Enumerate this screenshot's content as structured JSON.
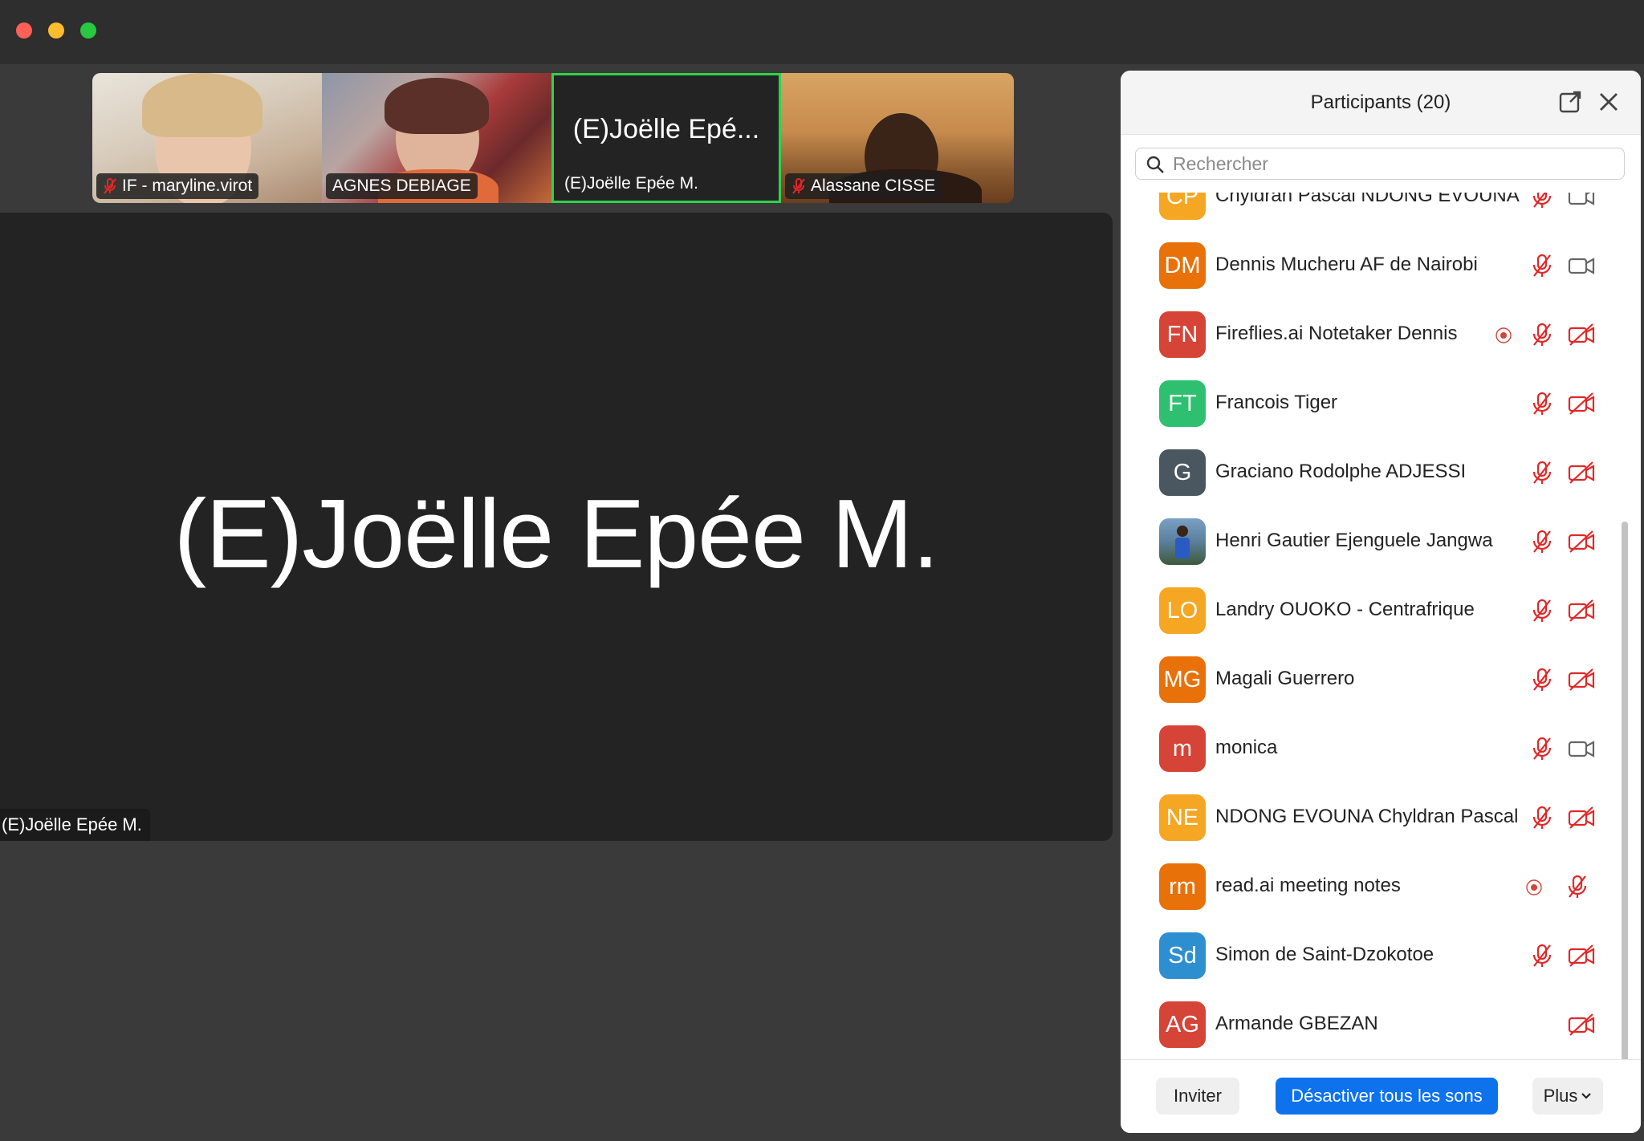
{
  "window": {
    "controls": [
      "close",
      "minimize",
      "zoom"
    ]
  },
  "thumbnails": [
    {
      "name": "IF - maryline.virot",
      "muted": true
    },
    {
      "name": "AGNES DEBIAGE",
      "muted": false
    },
    {
      "name": "(E)Joëlle Epée M.",
      "center_label": "(E)Joëlle Epé...",
      "muted": false,
      "active_speaker": true
    },
    {
      "name": "Alassane CISSE",
      "muted": true
    }
  ],
  "main": {
    "speaker_name": "(E)Joëlle Epée M.",
    "label": "(E)Joëlle Epée M."
  },
  "panel": {
    "title": "Participants (20)",
    "search_placeholder": "Rechercher",
    "participants": [
      {
        "initials": "CP",
        "name": "Chyldran Pascal NDONG EVOUNA",
        "color": "#f5a623",
        "recording": false,
        "mic": "off",
        "cam": "on"
      },
      {
        "initials": "DM",
        "name": "Dennis Mucheru AF de Nairobi",
        "color": "#e8710a",
        "recording": false,
        "mic": "off",
        "cam": "on"
      },
      {
        "initials": "FN",
        "name": "Fireflies.ai Notetaker Dennis",
        "color": "#d64437",
        "recording": true,
        "mic": "off",
        "cam": "off"
      },
      {
        "initials": "FT",
        "name": "Francois Tiger",
        "color": "#2fbf71",
        "recording": false,
        "mic": "off",
        "cam": "off"
      },
      {
        "initials": "G",
        "name": "Graciano Rodolphe ADJESSI",
        "color": "#4a5660",
        "recording": false,
        "mic": "off",
        "cam": "off"
      },
      {
        "initials": "",
        "name": "Henri Gautier Ejenguele Jangwa",
        "color": "#6d8fa8",
        "photo": true,
        "recording": false,
        "mic": "off",
        "cam": "off"
      },
      {
        "initials": "LO",
        "name": "Landry OUOKO - Centrafrique",
        "color": "#f5a623",
        "recording": false,
        "mic": "off",
        "cam": "off"
      },
      {
        "initials": "MG",
        "name": "Magali Guerrero",
        "color": "#e8710a",
        "recording": false,
        "mic": "off",
        "cam": "off"
      },
      {
        "initials": "m",
        "name": "monica",
        "color": "#d64437",
        "recording": false,
        "mic": "off",
        "cam": "on"
      },
      {
        "initials": "NE",
        "name": "NDONG EVOUNA Chyldran Pascal",
        "color": "#f5a623",
        "recording": false,
        "mic": "off",
        "cam": "off"
      },
      {
        "initials": "rm",
        "name": "read.ai meeting notes",
        "color": "#e8710a",
        "recording": true,
        "mic": "off",
        "cam": "none"
      },
      {
        "initials": "Sd",
        "name": "Simon de Saint-Dzokotoe",
        "color": "#2e8fd0",
        "recording": false,
        "mic": "off",
        "cam": "off"
      },
      {
        "initials": "AG",
        "name": "Armande GBEZAN",
        "color": "#d64437",
        "recording": false,
        "mic": "none",
        "cam": "off"
      }
    ],
    "footer": {
      "invite_label": "Inviter",
      "mute_all_label": "Désactiver tous les sons",
      "more_label": "Plus"
    }
  },
  "colors": {
    "accent_blue": "#0e72ed",
    "muted_red": "#e02828",
    "active_speaker_border": "#2fd24a"
  }
}
